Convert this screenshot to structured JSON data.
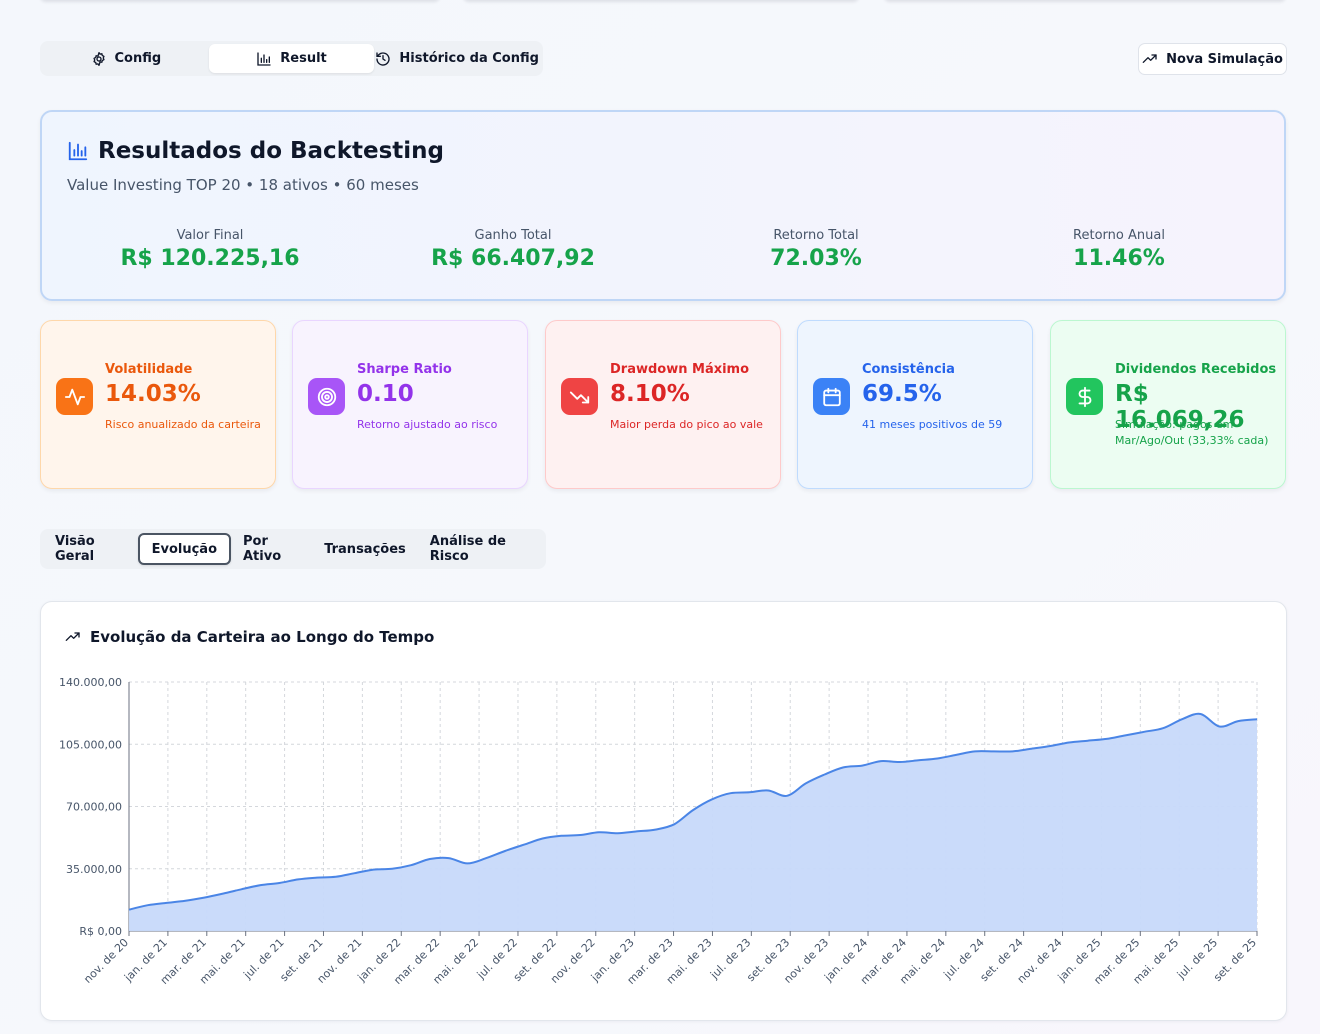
{
  "top_tabs": [
    {
      "label": "Config",
      "icon": "gear-icon"
    },
    {
      "label": "Result",
      "icon": "bar-chart-icon",
      "active": true
    },
    {
      "label": "Histórico da Config",
      "icon": "history-icon"
    }
  ],
  "new_simulation": {
    "label": "Nova Simulação",
    "icon": "trending-up-icon"
  },
  "results": {
    "title": "Resultados do Backtesting",
    "subtitle": "Value Investing TOP 20 • 18 ativos • 60 meses",
    "stats": [
      {
        "label": "Valor Final",
        "value": "R$ 120.225,16"
      },
      {
        "label": "Ganho Total",
        "value": "R$ 66.407,92"
      },
      {
        "label": "Retorno Total",
        "value": "72.03%"
      },
      {
        "label": "Retorno Anual",
        "value": "11.46%"
      }
    ]
  },
  "metrics": [
    {
      "title": "Volatilidade",
      "value": "14.03%",
      "desc": "Risco anualizado da carteira",
      "icon": "activity-icon",
      "accent": "#f97316"
    },
    {
      "title": "Sharpe Ratio",
      "value": "0.10",
      "desc": "Retorno ajustado ao risco",
      "icon": "target-icon",
      "accent": "#a855f7"
    },
    {
      "title": "Drawdown Máximo",
      "value": "8.10%",
      "desc": "Maior perda do pico ao vale",
      "icon": "trending-down-icon",
      "accent": "#ef4444"
    },
    {
      "title": "Consistência",
      "value": "69.5%",
      "desc": "41 meses positivos de 59",
      "icon": "calendar-icon",
      "accent": "#3b82f6"
    },
    {
      "title": "Dividendos Recebidos",
      "value": "R$ 16.069,26",
      "desc": "Simulação: pagos em Mar/Ago/Out (33,33% cada)",
      "icon": "dollar-icon",
      "accent": "#22c55e"
    }
  ],
  "chart_tabs": [
    {
      "label": "Visão Geral"
    },
    {
      "label": "Evolução",
      "active": true
    },
    {
      "label": "Por Ativo"
    },
    {
      "label": "Transações"
    },
    {
      "label": "Análise de Risco"
    }
  ],
  "chart_card": {
    "title": "Evolução da Carteira ao Longo do Tempo",
    "icon": "trending-up-icon"
  },
  "chart_data": {
    "type": "area",
    "title": "Evolução da Carteira ao Longo do Tempo",
    "xlabel": "",
    "ylabel": "",
    "ylim": [
      0,
      140000
    ],
    "yticks": [
      0,
      35000,
      70000,
      105000,
      140000
    ],
    "ytick_labels": [
      "R$ 0,00",
      "35.000,00",
      "70.000,00",
      "105.000,00",
      "140.000,00"
    ],
    "xtick_labels": [
      "nov. de 20",
      "jan. de 21",
      "mar. de 21",
      "mai. de 21",
      "jul. de 21",
      "set. de 21",
      "nov. de 21",
      "jan. de 22",
      "mar. de 22",
      "mai. de 22",
      "jul. de 22",
      "set. de 22",
      "nov. de 22",
      "jan. de 23",
      "mar. de 23",
      "mai. de 23",
      "jul. de 23",
      "set. de 23",
      "nov. de 23",
      "jan. de 24",
      "mar. de 24",
      "mai. de 24",
      "jul. de 24",
      "set. de 24",
      "nov. de 24",
      "jan. de 25",
      "mar. de 25",
      "mai. de 25",
      "jul. de 25",
      "set. de 25"
    ],
    "grid": true,
    "series": [
      {
        "color": "#4a85e6",
        "fill": "#c7d9fa",
        "values": [
          12000,
          14500,
          15800,
          17000,
          18800,
          21000,
          23500,
          25800,
          27000,
          29000,
          30000,
          30500,
          32500,
          34500,
          35000,
          37000,
          40500,
          41000,
          38000,
          41000,
          45000,
          48500,
          52000,
          53500,
          54000,
          55500,
          55000,
          56000,
          57000,
          60000,
          68000,
          74000,
          77500,
          78000,
          79000,
          76000,
          83000,
          88000,
          92000,
          93000,
          95500,
          95000,
          96000,
          97000,
          99000,
          101000,
          101000,
          101000,
          102500,
          104000,
          106000,
          107000,
          108000,
          110000,
          112000,
          114000,
          119000,
          122000,
          115000,
          118000,
          119000
        ]
      }
    ]
  }
}
